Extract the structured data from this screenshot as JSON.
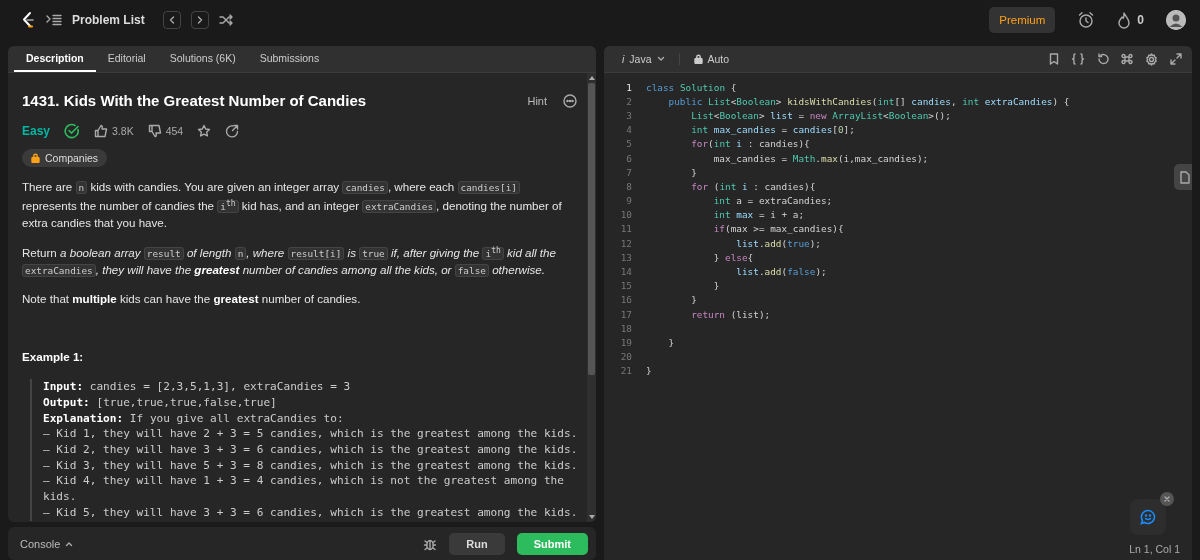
{
  "nav": {
    "title": "Problem List",
    "premium": "Premium",
    "streak": "0"
  },
  "tabs": [
    {
      "label": "Description",
      "selected": true
    },
    {
      "label": "Editorial",
      "selected": false
    },
    {
      "label": "Solutions (6K)",
      "selected": false
    },
    {
      "label": "Submissions",
      "selected": false
    }
  ],
  "problem": {
    "title": "1431. Kids With the Greatest Number of Candies",
    "hint": "Hint",
    "difficulty": "Easy",
    "solved": true,
    "likes": "3.8K",
    "dislikes": "454",
    "companies": "Companies"
  },
  "paragraphs": [
    [
      {
        "kind": "plain",
        "text": "There are "
      },
      {
        "kind": "code",
        "text": "n"
      },
      {
        "kind": "plain",
        "text": " kids with candies. You are given an integer array "
      },
      {
        "kind": "code",
        "text": "candies"
      },
      {
        "kind": "plain",
        "text": ", where each "
      },
      {
        "kind": "code",
        "text": "candies[i]"
      },
      {
        "kind": "plain",
        "text": " represents the number of candies the "
      },
      {
        "kind": "code",
        "text": "i$^{th}$"
      },
      {
        "kind": "plain",
        "text": " kid has, and an integer "
      },
      {
        "kind": "code",
        "text": "extraCandies"
      },
      {
        "kind": "plain",
        "text": ", denoting the number of extra candies that you have."
      }
    ],
    [
      {
        "kind": "plain",
        "text": "Return "
      },
      {
        "kind": "italic",
        "text": "a boolean array "
      },
      {
        "kind": "code",
        "text": "result"
      },
      {
        "kind": "italic",
        "text": " of length "
      },
      {
        "kind": "code",
        "text": "n"
      },
      {
        "kind": "italic",
        "text": ", where "
      },
      {
        "kind": "code",
        "text": "result[i]"
      },
      {
        "kind": "italic",
        "text": " is "
      },
      {
        "kind": "code",
        "text": "true"
      },
      {
        "kind": "italic",
        "text": " if, after giving the "
      },
      {
        "kind": "code",
        "text": "i$^{th}$"
      },
      {
        "kind": "italic",
        "text": " kid all the "
      },
      {
        "kind": "code",
        "text": "extraCandies"
      },
      {
        "kind": "italic",
        "text": ", they will have the "
      },
      {
        "kind": "strong-italic",
        "text": "greatest"
      },
      {
        "kind": "italic",
        "text": " number of candies among all the kids, or "
      },
      {
        "kind": "code",
        "text": "false"
      },
      {
        "kind": "italic",
        "text": " otherwise."
      }
    ],
    [
      {
        "kind": "plain",
        "text": "Note that "
      },
      {
        "kind": "strong",
        "text": "multiple"
      },
      {
        "kind": "plain",
        "text": " kids can have the "
      },
      {
        "kind": "strong",
        "text": "greatest"
      },
      {
        "kind": "plain",
        "text": " number of candies."
      }
    ]
  ],
  "example": {
    "title": "Example 1:",
    "fields": [
      {
        "label": "Input:",
        "text": "candies = [2,3,5,1,3], extraCandies = 3"
      },
      {
        "label": "Output:",
        "text": "[true,true,true,false,true]"
      },
      {
        "label": "Explanation:",
        "text": "If you give all extraCandies to:"
      }
    ],
    "lines": [
      "– Kid 1, they will have 2 + 3 = 5 candies, which is the greatest among the kids.",
      "– Kid 2, they will have 3 + 3 = 6 candies, which is the greatest among the kids.",
      "– Kid 3, they will have 5 + 3 = 8 candies, which is the greatest among the kids.",
      "– Kid 4, they will have 1 + 3 = 4 candies, which is not the greatest among the kids.",
      "– Kid 5, they will have 3 + 3 = 6 candies, which is the greatest among the kids."
    ]
  },
  "console": {
    "label": "Console",
    "run": "Run",
    "submit": "Submit"
  },
  "editor": {
    "language_icon": "i",
    "language": "Java",
    "mode": "Auto",
    "status": "Ln 1, Col 1",
    "lines": [
      {
        "number": "1",
        "current": true,
        "tokens": [
          {
            "kind": "kw",
            "text": "class"
          },
          {
            "kind": "type",
            "text": " Solution"
          },
          {
            "kind": "plain",
            "text": " {"
          }
        ]
      },
      {
        "number": "2",
        "current": false,
        "tokens": [
          {
            "kind": "kw",
            "text": "    public"
          },
          {
            "kind": "type",
            "text": " List"
          },
          {
            "kind": "plain",
            "text": "<"
          },
          {
            "kind": "type",
            "text": "Boolean"
          },
          {
            "kind": "plain",
            "text": "> "
          },
          {
            "kind": "fn",
            "text": "kidsWithCandies"
          },
          {
            "kind": "plain",
            "text": "("
          },
          {
            "kind": "type",
            "text": "int"
          },
          {
            "kind": "plain",
            "text": "[] "
          },
          {
            "kind": "var",
            "text": "candies"
          },
          {
            "kind": "plain",
            "text": ", "
          },
          {
            "kind": "type",
            "text": "int"
          },
          {
            "kind": "var",
            "text": " extraCandies"
          },
          {
            "kind": "plain",
            "text": ") {"
          }
        ]
      },
      {
        "number": "3",
        "current": false,
        "tokens": [
          {
            "kind": "type",
            "text": "        List"
          },
          {
            "kind": "plain",
            "text": "<"
          },
          {
            "kind": "type",
            "text": "Boolean"
          },
          {
            "kind": "plain",
            "text": "> "
          },
          {
            "kind": "var",
            "text": "list"
          },
          {
            "kind": "plain",
            "text": " = "
          },
          {
            "kind": "ctrl",
            "text": "new"
          },
          {
            "kind": "type",
            "text": " ArrayList"
          },
          {
            "kind": "plain",
            "text": "<"
          },
          {
            "kind": "type",
            "text": "Boolean"
          },
          {
            "kind": "plain",
            "text": ">();"
          }
        ]
      },
      {
        "number": "4",
        "current": false,
        "tokens": [
          {
            "kind": "type",
            "text": "        int"
          },
          {
            "kind": "var",
            "text": " max_candies"
          },
          {
            "kind": "plain",
            "text": " = "
          },
          {
            "kind": "var",
            "text": "candies"
          },
          {
            "kind": "plain",
            "text": "["
          },
          {
            "kind": "num",
            "text": "0"
          },
          {
            "kind": "plain",
            "text": "];"
          }
        ]
      },
      {
        "number": "5",
        "current": false,
        "tokens": [
          {
            "kind": "ctrl",
            "text": "        for"
          },
          {
            "kind": "plain",
            "text": "("
          },
          {
            "kind": "type",
            "text": "int"
          },
          {
            "kind": "var",
            "text": " i"
          },
          {
            "kind": "plain",
            "text": " : candies){"
          }
        ]
      },
      {
        "number": "6",
        "current": false,
        "tokens": [
          {
            "kind": "plain",
            "text": "            max_candies = "
          },
          {
            "kind": "type",
            "text": "Math"
          },
          {
            "kind": "plain",
            "text": "."
          },
          {
            "kind": "fn",
            "text": "max"
          },
          {
            "kind": "plain",
            "text": "(i,max_candies);"
          }
        ]
      },
      {
        "number": "7",
        "current": false,
        "tokens": [
          {
            "kind": "plain",
            "text": "        }"
          }
        ]
      },
      {
        "number": "8",
        "current": false,
        "tokens": [
          {
            "kind": "ctrl",
            "text": "        for"
          },
          {
            "kind": "plain",
            "text": " ("
          },
          {
            "kind": "type",
            "text": "int"
          },
          {
            "kind": "var",
            "text": " i"
          },
          {
            "kind": "plain",
            "text": " : candies){"
          }
        ]
      },
      {
        "number": "9",
        "current": false,
        "tokens": [
          {
            "kind": "type",
            "text": "            int"
          },
          {
            "kind": "plain",
            "text": " a = extraCandies;"
          }
        ]
      },
      {
        "number": "10",
        "current": false,
        "tokens": [
          {
            "kind": "type",
            "text": "            int"
          },
          {
            "kind": "var",
            "text": " max"
          },
          {
            "kind": "plain",
            "text": " = i + a;"
          }
        ]
      },
      {
        "number": "11",
        "current": false,
        "tokens": [
          {
            "kind": "ctrl",
            "text": "            if"
          },
          {
            "kind": "plain",
            "text": "(max >= max_candies){"
          }
        ]
      },
      {
        "number": "12",
        "current": false,
        "tokens": [
          {
            "kind": "var",
            "text": "                list"
          },
          {
            "kind": "plain",
            "text": "."
          },
          {
            "kind": "fn",
            "text": "add"
          },
          {
            "kind": "plain",
            "text": "("
          },
          {
            "kind": "kw",
            "text": "true"
          },
          {
            "kind": "plain",
            "text": ");"
          }
        ]
      },
      {
        "number": "13",
        "current": false,
        "tokens": [
          {
            "kind": "plain",
            "text": "            } "
          },
          {
            "kind": "ctrl",
            "text": "else"
          },
          {
            "kind": "plain",
            "text": "{"
          }
        ]
      },
      {
        "number": "14",
        "current": false,
        "tokens": [
          {
            "kind": "var",
            "text": "                list"
          },
          {
            "kind": "plain",
            "text": "."
          },
          {
            "kind": "fn",
            "text": "add"
          },
          {
            "kind": "plain",
            "text": "("
          },
          {
            "kind": "kw",
            "text": "false"
          },
          {
            "kind": "plain",
            "text": ");"
          }
        ]
      },
      {
        "number": "15",
        "current": false,
        "tokens": [
          {
            "kind": "plain",
            "text": "            }"
          }
        ]
      },
      {
        "number": "16",
        "current": false,
        "tokens": [
          {
            "kind": "plain",
            "text": "        }"
          }
        ]
      },
      {
        "number": "17",
        "current": false,
        "tokens": [
          {
            "kind": "ctrl",
            "text": "        return"
          },
          {
            "kind": "plain",
            "text": " (list);"
          }
        ]
      },
      {
        "number": "18",
        "current": false
      },
      {
        "number": "19",
        "current": false,
        "tokens": [
          {
            "kind": "plain",
            "text": "    }"
          }
        ]
      },
      {
        "number": "20",
        "current": false
      },
      {
        "number": "21",
        "current": false,
        "tokens": [
          {
            "kind": "plain",
            "text": "}"
          }
        ]
      }
    ]
  }
}
